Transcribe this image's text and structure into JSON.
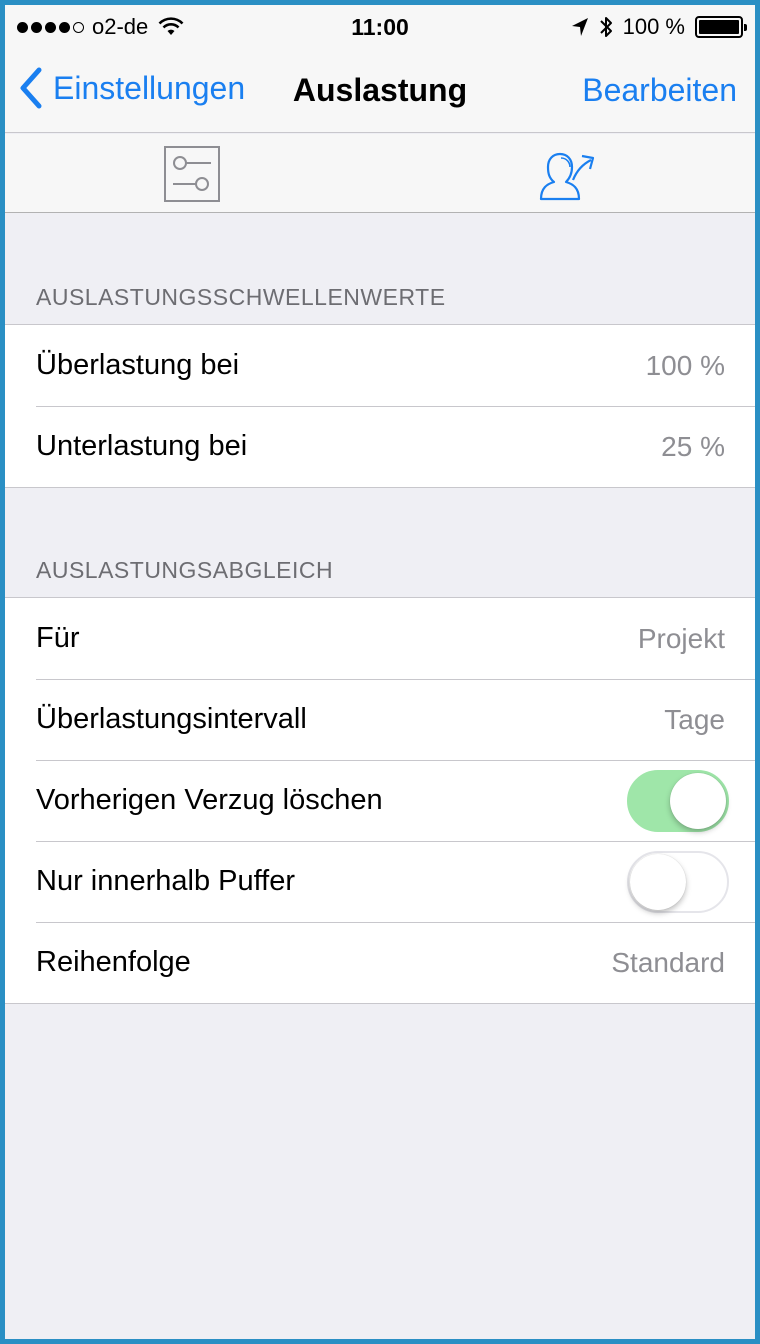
{
  "status_bar": {
    "carrier": "o2-de",
    "time": "11:00",
    "battery_label": "100 %"
  },
  "nav": {
    "back_label": "Einstellungen",
    "title": "Auslastung",
    "edit_label": "Bearbeiten"
  },
  "tabs": [
    {
      "icon": "sliders-icon",
      "selected": false
    },
    {
      "icon": "person-share-icon",
      "selected": true
    }
  ],
  "sections": [
    {
      "header": "AUSLASTUNGSSCHWELLENWERTE",
      "rows": [
        {
          "label": "Überlastung bei",
          "value": "100 %"
        },
        {
          "label": "Unterlastung bei",
          "value": "25 %"
        }
      ]
    },
    {
      "header": "AUSLASTUNGSABGLEICH",
      "rows": [
        {
          "label": "Für",
          "value": "Projekt"
        },
        {
          "label": "Überlastungsintervall",
          "value": "Tage"
        },
        {
          "label": "Vorherigen Verzug löschen",
          "toggle": true
        },
        {
          "label": "Nur innerhalb Puffer",
          "toggle": false
        },
        {
          "label": "Reihenfolge",
          "value": "Standard"
        }
      ]
    }
  ],
  "colors": {
    "accent": "#1a7ff0",
    "toggle_on": "#9fe6a9",
    "background": "#efeff4",
    "frame": "#2a8fc4"
  }
}
